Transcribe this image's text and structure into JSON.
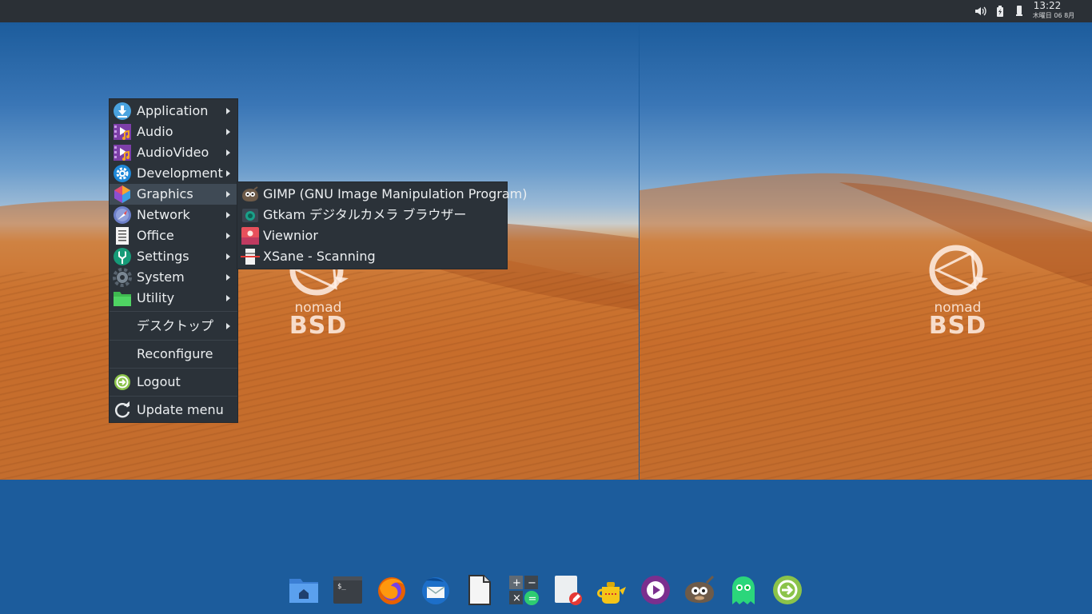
{
  "topbar": {
    "tray_icons": [
      "volume-icon",
      "battery-icon",
      "removable-drive-icon"
    ],
    "clock_time": "13:22",
    "clock_date": "木曜日 06 8月"
  },
  "wallpaper": {
    "logo_nomad": "nomad",
    "logo_bsd": "BSD"
  },
  "menu": {
    "items": [
      {
        "label": "Application",
        "icon": "download-icon"
      },
      {
        "label": "Audio",
        "icon": "audio-icon"
      },
      {
        "label": "AudioVideo",
        "icon": "audiovideo-icon"
      },
      {
        "label": "Development",
        "icon": "development-gear-icon"
      },
      {
        "label": "Graphics",
        "icon": "graphics-icon"
      },
      {
        "label": "Network",
        "icon": "network-icon"
      },
      {
        "label": "Office",
        "icon": "office-document-icon"
      },
      {
        "label": "Settings",
        "icon": "settings-icon"
      },
      {
        "label": "System",
        "icon": "system-gear-icon"
      },
      {
        "label": "Utility",
        "icon": "utility-icon"
      }
    ],
    "desktop_label": "デスクトップ",
    "reconfigure_label": "Reconfigure",
    "logout_label": "Logout",
    "update_label": "Update menu"
  },
  "graphics_submenu": {
    "items": [
      {
        "label": "GIMP (GNU Image Manipulation Program)",
        "icon": "gimp-icon"
      },
      {
        "label": "Gtkam デジタルカメラ ブラウザー",
        "icon": "camera-icon"
      },
      {
        "label": "Viewnior",
        "icon": "image-viewer-icon"
      },
      {
        "label": "XSane - Scanning",
        "icon": "scanner-icon"
      }
    ]
  },
  "dock": {
    "icons": [
      "home-folder-icon",
      "terminal-icon",
      "firefox-icon",
      "thunderbird-icon",
      "document-viewer-icon",
      "calculator-icon",
      "text-editor-icon",
      "teapot-icon",
      "media-player-icon",
      "gimp-icon",
      "ghost-icon",
      "logout-icon"
    ]
  },
  "colors": {
    "panel": "#2b3036",
    "menu_bg": "#2b3239",
    "menu_active": "#3f4a55",
    "desktop_blue": "#1c5c9c"
  }
}
